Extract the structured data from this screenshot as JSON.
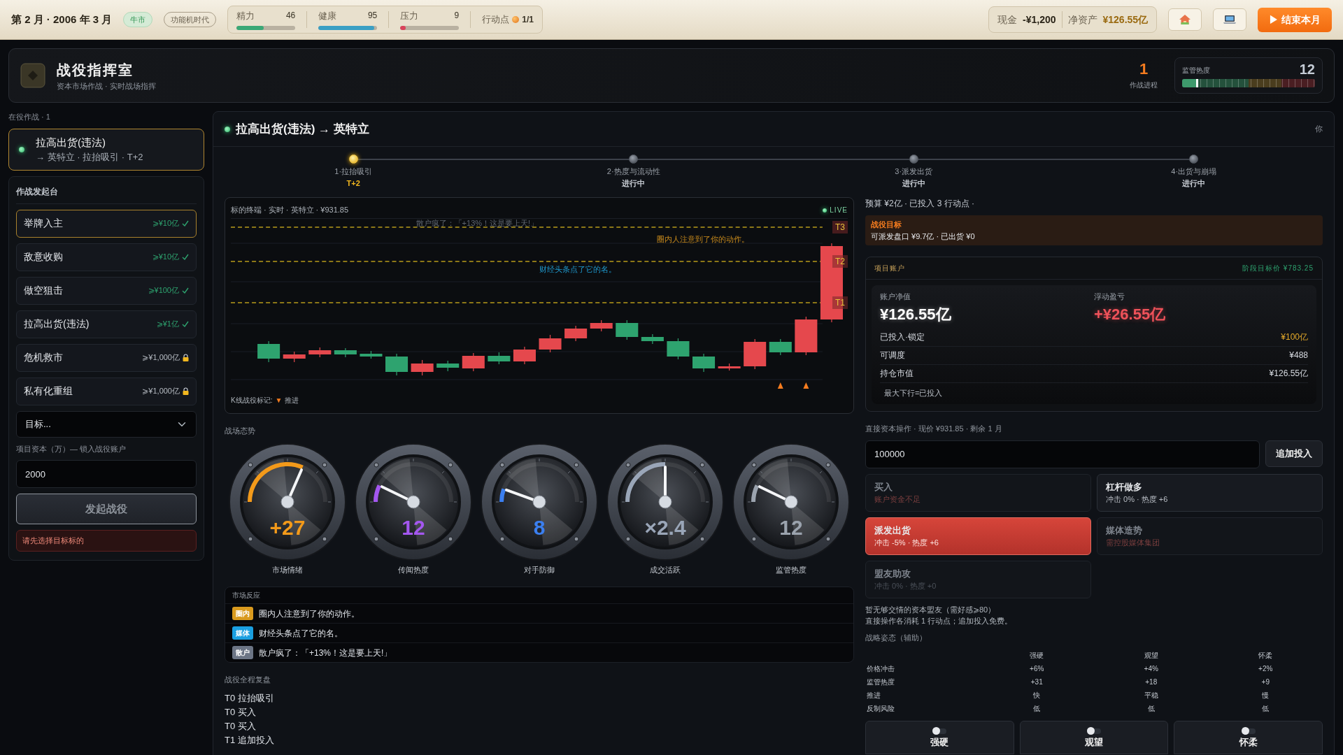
{
  "topbar": {
    "date": "第 2 月 · 2006 年 3 月",
    "tags": [
      {
        "label": "牛市",
        "kind": "market"
      },
      {
        "label": "功能机时代",
        "kind": "era"
      }
    ],
    "stats": [
      {
        "label": "精力",
        "value": "46",
        "level": 0.46,
        "color": "#3aa876"
      },
      {
        "label": "健康",
        "value": "95",
        "level": 0.95,
        "color": "#3a9fc4"
      },
      {
        "label": "压力",
        "value": "9",
        "level": 0.09,
        "color": "#d9435a"
      }
    ],
    "action_points": {
      "label": "行动点",
      "value": "1/1"
    },
    "cash": {
      "label": "现金",
      "value": "-¥1,200"
    },
    "net_worth": {
      "label": "净资产",
      "value": "¥126.55亿"
    },
    "end_button": "▶ 结束本月"
  },
  "header": {
    "title": "战役指挥室",
    "subtitle": "资本市场作战 · 实时战场指挥",
    "progress": {
      "value": "1",
      "label": "作战进程"
    },
    "heat": {
      "label": "监管热度",
      "value": "12",
      "level": 0.12
    }
  },
  "sidebar": {
    "active_label": "在役作战 · 1",
    "active_ops": [
      {
        "title": "拉高出货(违法)",
        "subtitle": "→ 英特立 · 拉抬吸引 · T+2"
      }
    ],
    "launchpad": {
      "title": "作战发起台",
      "operations": [
        {
          "name": "举牌入主",
          "requirement": "⩾¥10亿",
          "locked": false,
          "selected": true
        },
        {
          "name": "敌意收购",
          "requirement": "⩾¥10亿",
          "locked": false,
          "selected": false
        },
        {
          "name": "做空狙击",
          "requirement": "⩾¥100亿",
          "locked": false,
          "selected": false
        },
        {
          "name": "拉高出货(违法)",
          "requirement": "⩾¥1亿",
          "locked": false,
          "selected": false
        },
        {
          "name": "危机救市",
          "requirement": "⩾¥1,000亿",
          "locked": true,
          "selected": false
        },
        {
          "name": "私有化重组",
          "requirement": "⩾¥1,000亿",
          "locked": true,
          "selected": false
        }
      ],
      "target": "目标...",
      "capital_label": "项目资本（万）— 锁入战役账户",
      "capital_value": "2000",
      "launch_button": {
        "label": "发起战役",
        "disabled": true
      },
      "error": "请先选择目标标的"
    }
  },
  "campaign": {
    "title": "拉高出货(违法) → 英特立",
    "user": "你",
    "steps": [
      {
        "label": "1·拉抬吸引",
        "status": "T+2",
        "selected": true
      },
      {
        "label": "2·热度与流动性",
        "status": "进行中",
        "selected": false
      },
      {
        "label": "3·派发出货",
        "status": "进行中",
        "selected": false
      },
      {
        "label": "4·出货与崩塌",
        "status": "进行中",
        "selected": false
      }
    ],
    "terminal": {
      "title": "标的终端 · 实时 · 英特立 · ¥931.85",
      "live": "LIVE",
      "targets": [
        "T3",
        "T2",
        "T1"
      ],
      "overlays": [
        {
          "text": "散户疯了：「+13%！这是要上天!」",
          "kind": "retail"
        },
        {
          "text": "圈内人注意到了你的动作。",
          "kind": "insider"
        },
        {
          "text": "财经头条点了它的名。",
          "kind": "media"
        }
      ],
      "legend": {
        "label": "K线战役标记:",
        "marker": "▼",
        "text": "推进"
      }
    },
    "situation": {
      "title": "战场态势",
      "gauges": [
        {
          "value": "+27",
          "label": "市场情绪",
          "level": 0.7,
          "color": "#f39a1a"
        },
        {
          "value": "12",
          "label": "传闻热度",
          "level": 0.05,
          "color": "#a457f0"
        },
        {
          "value": "8",
          "label": "对手防御",
          "level": 0.03,
          "color": "#3b7ff0"
        },
        {
          "value": "×2.4",
          "label": "成交活跃",
          "level": 0.5,
          "color": "#9aa6b8"
        },
        {
          "value": "12",
          "label": "监管热度",
          "level": 0.05,
          "color": "#9ba3ae"
        }
      ]
    },
    "reactions": {
      "title": "市场反应",
      "items": [
        {
          "tag": "圈内",
          "color": "#d99a1e",
          "text": "圈内人注意到了你的动作。"
        },
        {
          "tag": "媒体",
          "color": "#1a9fe0",
          "text": "财经头条点了它的名。"
        },
        {
          "tag": "散户",
          "color": "#6c7585",
          "text": "散户疯了：「+13%！这是要上天!」"
        }
      ]
    },
    "replay": {
      "title": "战役全程复盘",
      "entries": [
        "T0 拉抬吸引",
        "T0 买入",
        "T0 买入",
        "T1 追加投入"
      ]
    }
  },
  "budget": "预算 ¥2亿 · 已投入 3 行动点 ·",
  "goal": {
    "title": "战役目标",
    "text": "可派发盘口 ¥9.7亿 · 已出货 ¥0"
  },
  "account": {
    "title": "项目账户",
    "target_price": "阶段目标价 ¥783.25",
    "net_label": "账户净值",
    "net_value": "¥126.55亿",
    "pnl_label": "浮动盈亏",
    "pnl_value": "+¥26.55亿",
    "rows": [
      {
        "label": "已投入·锁定",
        "value": "¥100亿",
        "highlight": true
      },
      {
        "label": "可调度",
        "value": "¥488",
        "highlight": false
      },
      {
        "label": "持仓市值",
        "value": "¥126.55亿",
        "highlight": false
      }
    ],
    "note": "最大下行=已投入"
  },
  "direct": {
    "label": "直接资本操作 · 现价 ¥931.85 · 剩余 1 月",
    "amount": "100000",
    "add_button": "追加投入",
    "actions": [
      {
        "title": "买入",
        "detail": "账户资金不足",
        "disabled": true,
        "warning": true,
        "selected": false
      },
      {
        "title": "杠杆做多",
        "detail": "冲击 0% · 热度 +6",
        "disabled": false,
        "warning": false,
        "selected": false
      },
      {
        "title": "派发出货",
        "detail": "冲击 -5% · 热度 +6",
        "disabled": false,
        "warning": false,
        "selected": true
      },
      {
        "title": "媒体造势",
        "detail": "需控股媒体集团",
        "disabled": true,
        "warning": true,
        "selected": false
      },
      {
        "title": "盟友助攻",
        "detail": "冲击 0% · 热度 +0",
        "disabled": true,
        "warning": false,
        "selected": false
      }
    ],
    "notes": [
      "暂无够交情的资本盟友（需好感⩾80）",
      "直接操作各消耗 1 行动点；追加投入免费。"
    ]
  },
  "stance": {
    "title": "战略姿态（辅助）",
    "columns": [
      "强硬",
      "观望",
      "怀柔"
    ],
    "rows": [
      {
        "label": "价格冲击",
        "values": [
          "+6%",
          "+4%",
          "+2%"
        ]
      },
      {
        "label": "监管热度",
        "values": [
          "+31",
          "+18",
          "+9"
        ]
      },
      {
        "label": "推进",
        "values": [
          "快",
          "平稳",
          "慢"
        ]
      },
      {
        "label": "反制风险",
        "values": [
          "低",
          "低",
          "低"
        ]
      }
    ],
    "buttons": [
      {
        "label": "强硬",
        "on": false
      },
      {
        "label": "观望",
        "on": false
      },
      {
        "label": "怀柔",
        "on": false
      }
    ]
  }
}
